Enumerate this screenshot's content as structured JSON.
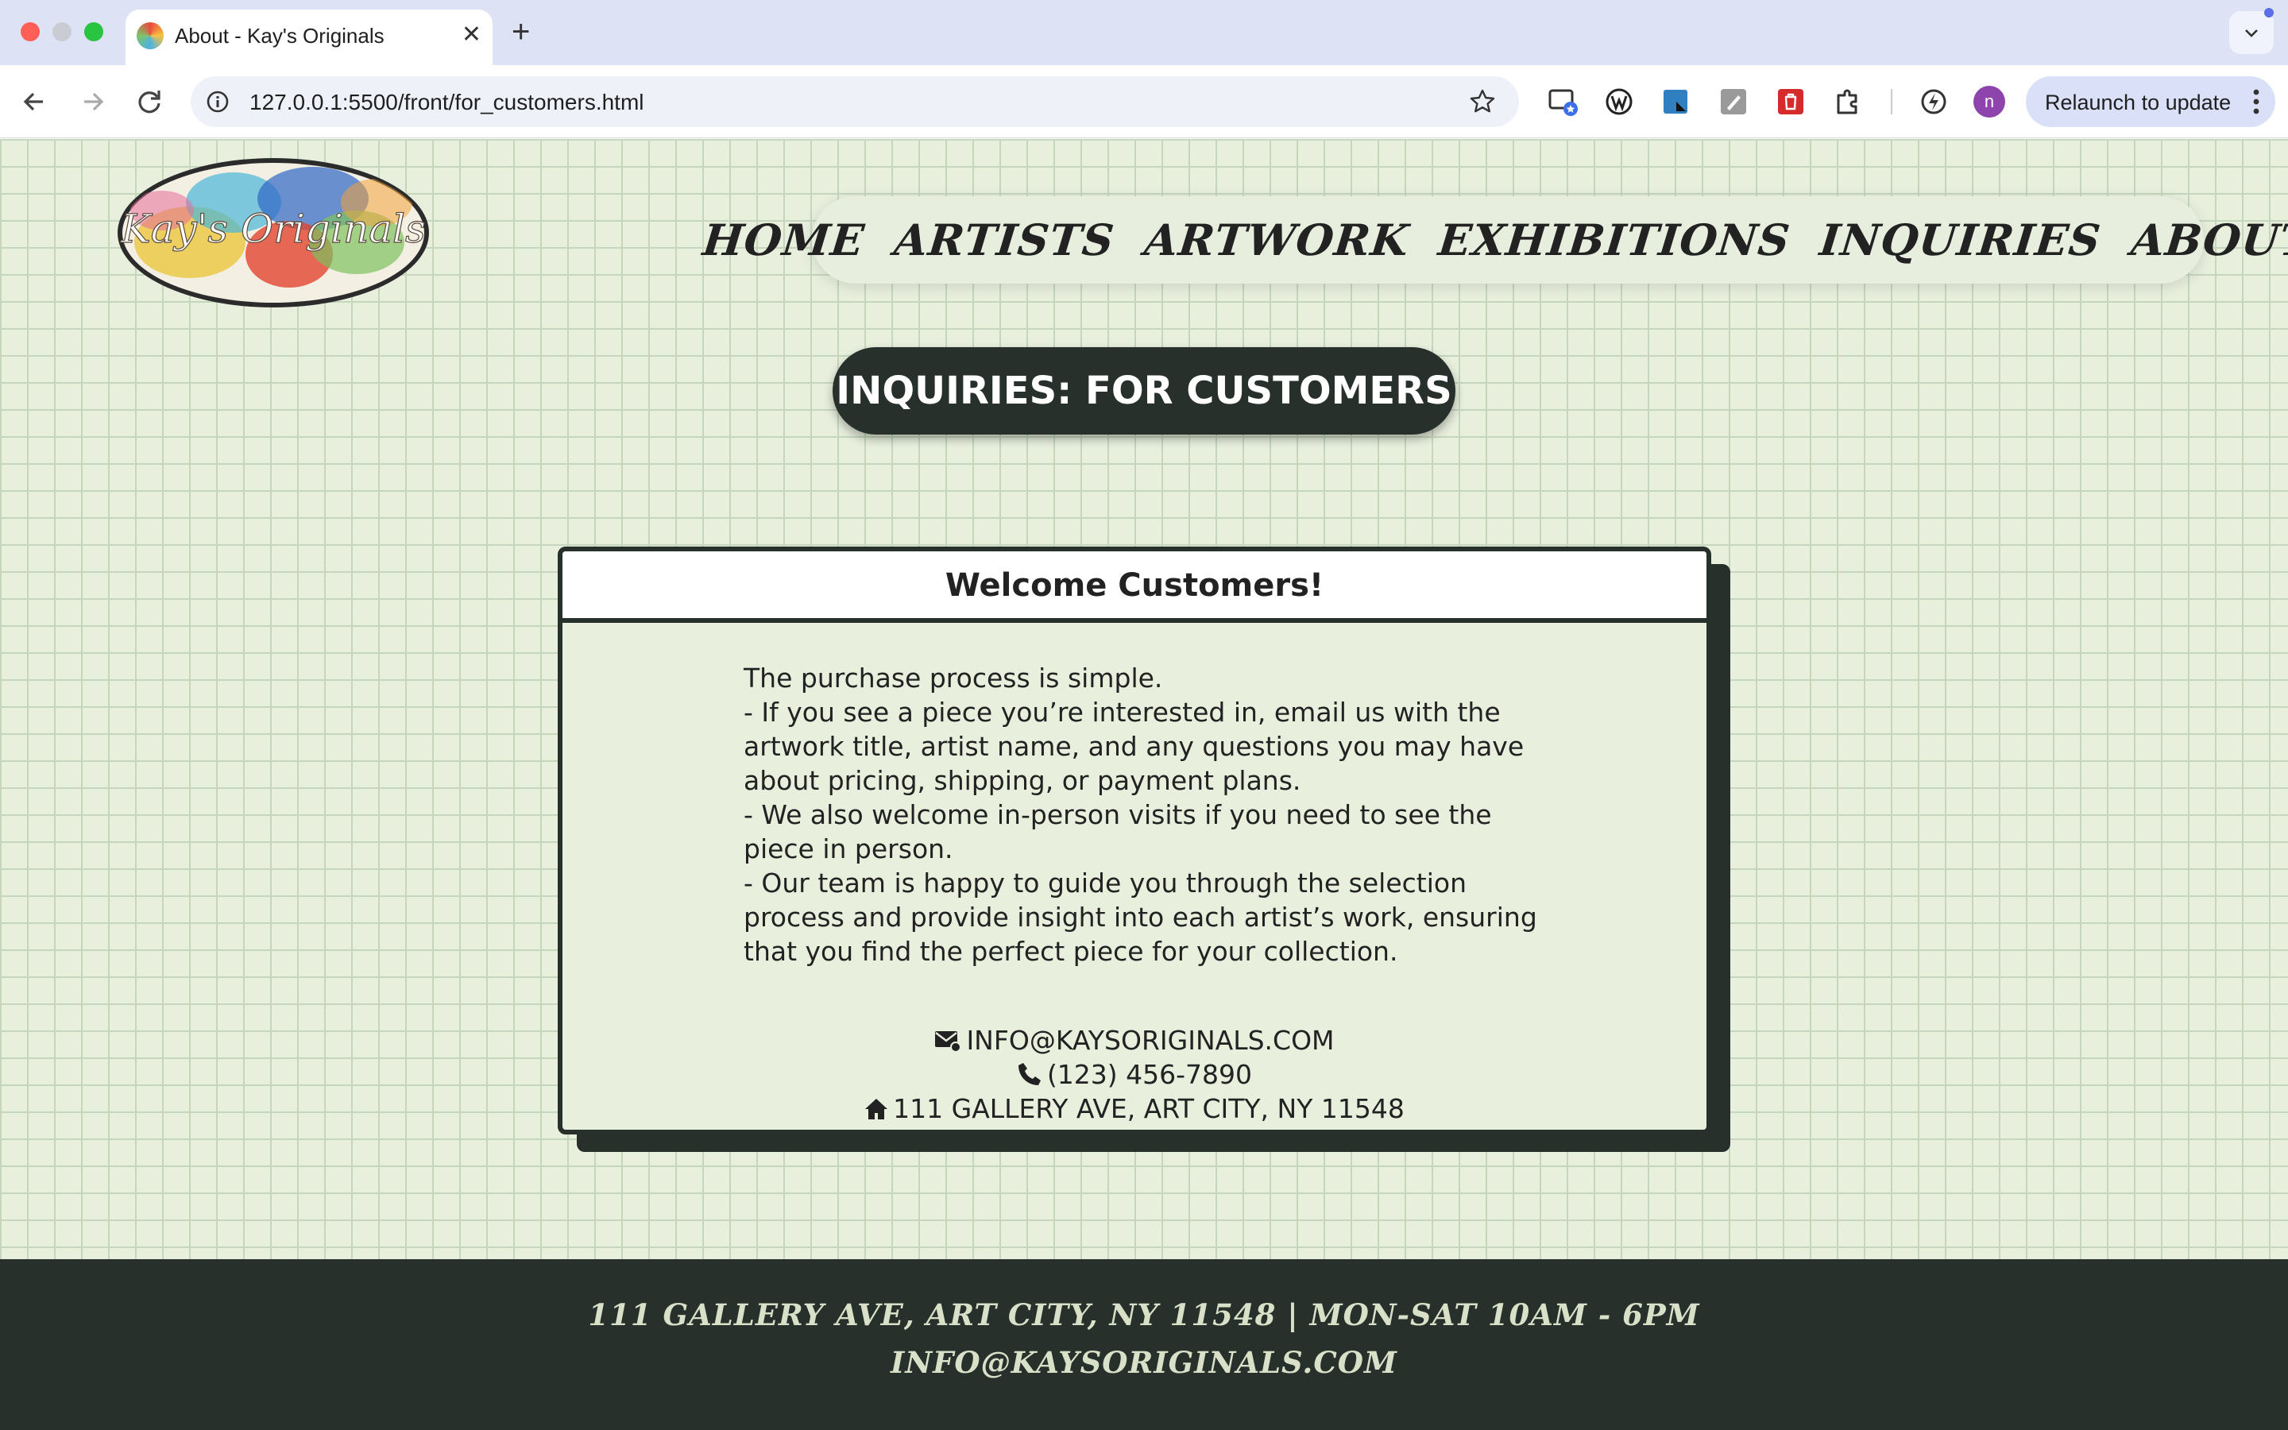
{
  "browser": {
    "tab_title": "About - Kay's Originals",
    "url": "127.0.0.1:5500/front/for_customers.html",
    "relaunch_label": "Relaunch to update",
    "profile_initial": "n"
  },
  "logo": {
    "text": "Kay's Originals"
  },
  "nav": {
    "items": [
      "HOME",
      "ARTISTS",
      "ARTWORK",
      "EXHIBITIONS",
      "INQUIRIES",
      "ABOUT"
    ]
  },
  "page_title": "INQUIRIES: FOR CUSTOMERS",
  "card": {
    "title": "Welcome Customers!",
    "intro": "The purchase process is simple.",
    "bullets": [
      "- If you see a piece you’re interested in, email us with the artwork title, artist name, and any questions you may have about pricing, shipping, or payment plans.",
      "- We also welcome in-person visits if you need to see the piece in person.",
      "- Our team is happy to guide you through the selection process and provide insight into each artist’s work, ensuring that you find the perfect piece for your collection."
    ],
    "email": "INFO@KAYSORIGINALS.COM",
    "phone": "(123) 456-7890",
    "address": "111 GALLERY AVE, ART CITY, NY 11548"
  },
  "footer": {
    "line1": "111 GALLERY AVE, ART CITY, NY 11548 | MON-SAT 10AM - 6PM",
    "line2": "INFO@KAYSORIGINALS.COM"
  },
  "colors": {
    "dark": "#28302c",
    "page_bg": "#e8efdd",
    "grid": "#c6d6bd"
  }
}
